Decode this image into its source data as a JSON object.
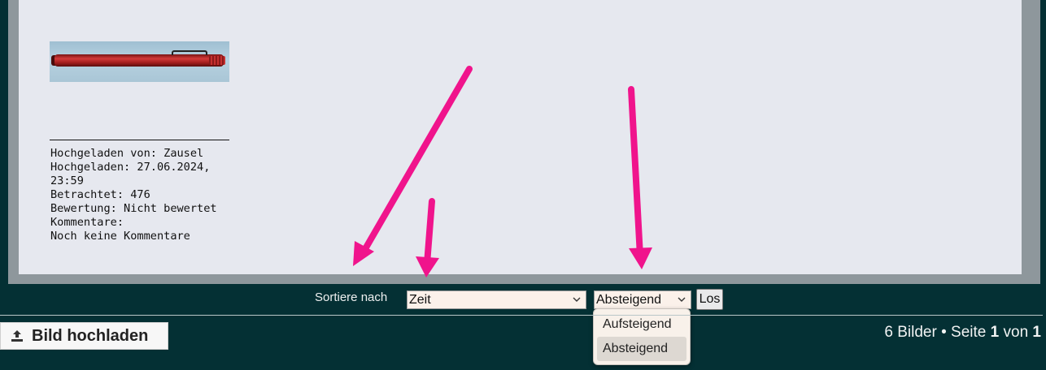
{
  "gallery": {
    "image": {
      "alt": "Rote Taschenlampe"
    },
    "info": {
      "uploaded_by": "Hochgeladen von: Zausel",
      "uploaded_at_1": "Hochgeladen: 27.06.2024,",
      "uploaded_at_2": "23:59",
      "views": "Betrachtet: 476",
      "rating": "Bewertung: Nicht bewertet",
      "comments_label": "Kommentare:",
      "comments_value": "Noch keine Kommentare"
    }
  },
  "sort": {
    "label": "Sortiere nach",
    "field_value": "Zeit",
    "order_value": "Absteigend",
    "go_label": "Los",
    "order_options": [
      "Aufsteigend",
      "Absteigend"
    ],
    "order_selected_index": 1
  },
  "footer": {
    "upload_label": "Bild hochladen",
    "image_count": "6 Bilder",
    "separator": "•",
    "page_word": "Seite",
    "page_current": "1",
    "of_word": "von",
    "page_total": "1"
  },
  "colors": {
    "background": "#043034",
    "panel": "#e6e8ef",
    "frame": "#8e979c",
    "annotation_arrow": "#f0148c"
  },
  "icons": {
    "upload": "upload-icon",
    "dropdown": "chevron-down-icon"
  }
}
